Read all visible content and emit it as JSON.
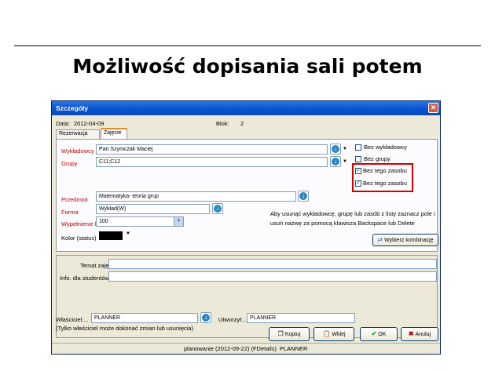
{
  "slide": {
    "title": "Możliwość dopisania sali potem"
  },
  "dialog": {
    "title": "Szczegóły",
    "data_label": "Data:",
    "data_value": "2012-04-09",
    "blok_label": "Blok:",
    "blok_value": "2",
    "tabs": [
      {
        "label": "Rezerwacja"
      },
      {
        "label": "Zajęcie"
      }
    ],
    "wykladowcy_label": "Wykładowcy",
    "wykladowcy_value": "Pan Szymczak Maciej",
    "grupy_label": "Grupy",
    "grupy_value": "C11;C12",
    "checkboxes": [
      {
        "label": "Bez wykładowcy",
        "checked": false
      },
      {
        "label": "Bez grupy",
        "checked": false
      },
      {
        "label": "Bez tego zasobu",
        "checked": true
      },
      {
        "label": "Bez tego zasobu",
        "checked": true
      }
    ],
    "przedmiot_label": "Przedmiot",
    "przedmiot_value": "Matematyka- teoria grup",
    "forma_label": "Forma",
    "forma_value": "Wykład(W)",
    "wypelnienie_label": "Wypełnienie bl.",
    "wypelnienie_value": "100",
    "kolor_label": "Kolor (status)",
    "hint_text_1": "Aby usunąć wykładowcę, grupę lub zasób z listy zaznacz pole i",
    "hint_text_2": "usuń nazwę za pomocą klawisza Backspace lub Delete",
    "wybierz_label": "Wybierz kombinację",
    "temat_label": "Temat zajęć",
    "info_label": "Info. dla studentów",
    "wlasciciel_label": "Właściciel:...",
    "wlasciciel_value": "PLANNER",
    "wlasciciel_note": "(Tylko właściciel może dokonać zmian lub usunięcia)",
    "utworzyl_label": "Utworzył:...",
    "utworzyl_value": "PLANNER",
    "buttons": {
      "kopiuj": "Kopiuj",
      "wklej": "Wklej",
      "ok": "OK",
      "anuluj": "Anuluj"
    },
    "status_text": "planowanie (2012-09-22) (FDetails)",
    "status_user": "PLANNER"
  }
}
